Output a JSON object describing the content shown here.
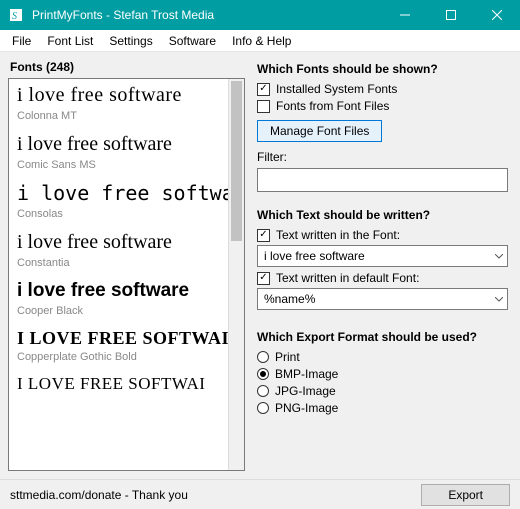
{
  "window": {
    "title": "PrintMyFonts - Stefan Trost Media"
  },
  "menu": [
    "File",
    "Font List",
    "Settings",
    "Software",
    "Info & Help"
  ],
  "left": {
    "heading": "Fonts (248)",
    "samples": [
      {
        "text": "i love free software",
        "name": "Colonna MT",
        "css": "font-family:'Times New Roman',serif; font-size:20px; letter-spacing:0.5px;"
      },
      {
        "text": "i love free software",
        "name": "Comic Sans MS",
        "css": "font-family:'Comic Sans MS',cursive; font-size:20px;"
      },
      {
        "text": "i love free softwar",
        "name": "Consolas",
        "css": "font-family:Consolas,monospace; font-size:20px;"
      },
      {
        "text": "i love free software",
        "name": "Constantia",
        "css": "font-family:Constantia,Georgia,serif; font-size:20px;"
      },
      {
        "text": "i love free software",
        "name": "Cooper Black",
        "css": "font-family:Impact,'Arial Black',sans-serif; font-size:19px; font-weight:900;"
      },
      {
        "text": "I LOVE FREE SOFTWAI",
        "name": "Copperplate Gothic Bold",
        "css": "font-family:Georgia,serif; font-size:18px; font-weight:bold; letter-spacing:0.5px;"
      },
      {
        "text": "I LOVE FREE SOFTWAI",
        "name": "",
        "css": "font-family:Georgia,serif; font-size:17px; letter-spacing:0.5px;"
      }
    ]
  },
  "right": {
    "show_heading": "Which Fonts should be shown?",
    "cb_installed": "Installed System Fonts",
    "cb_fontfiles": "Fonts from Font Files",
    "manage_btn": "Manage Font Files",
    "filter_label": "Filter:",
    "filter_value": "",
    "text_heading": "Which Text should be written?",
    "cb_text_font": "Text written in the Font:",
    "combo_text_font": "i love free software",
    "cb_text_default": "Text written in default Font:",
    "combo_text_default": "%name%",
    "export_heading": "Which Export Format should be used?",
    "radio_print": "Print",
    "radio_bmp": "BMP-Image",
    "radio_jpg": "JPG-Image",
    "radio_png": "PNG-Image"
  },
  "status": {
    "left": "sttmedia.com/donate - Thank you",
    "export_btn": "Export"
  }
}
